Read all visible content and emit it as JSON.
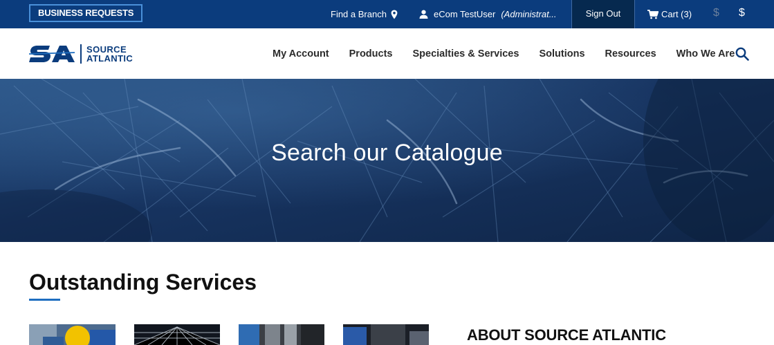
{
  "topbar": {
    "business_requests": "BUSINESS REQUESTS",
    "find_branch": "Find a Branch",
    "user_name": "eCom TestUser",
    "user_role": "(Administrat...",
    "sign_out": "Sign Out",
    "cart_label": "Cart (3)",
    "currency_1": "$",
    "currency_2": "$"
  },
  "logo": {
    "line1": "SOURCE",
    "line2": "ATLANTIC"
  },
  "nav": {
    "items": [
      {
        "label": "My Account"
      },
      {
        "label": "Products"
      },
      {
        "label": "Specialties & Services"
      },
      {
        "label": "Solutions"
      },
      {
        "label": "Resources"
      },
      {
        "label": "Who We Are"
      }
    ]
  },
  "hero": {
    "title": "Search our Catalogue"
  },
  "services": {
    "title": "Outstanding Services"
  },
  "about": {
    "title": "ABOUT SOURCE ATLANTIC"
  },
  "colors": {
    "brand_navy": "#0b3c7d",
    "sign_out_bg": "#06294f",
    "accent_blue": "#1e6ec0"
  },
  "icons": {
    "branch": "map-pin-icon",
    "user": "user-icon",
    "cart": "cart-icon",
    "search": "search-icon"
  }
}
